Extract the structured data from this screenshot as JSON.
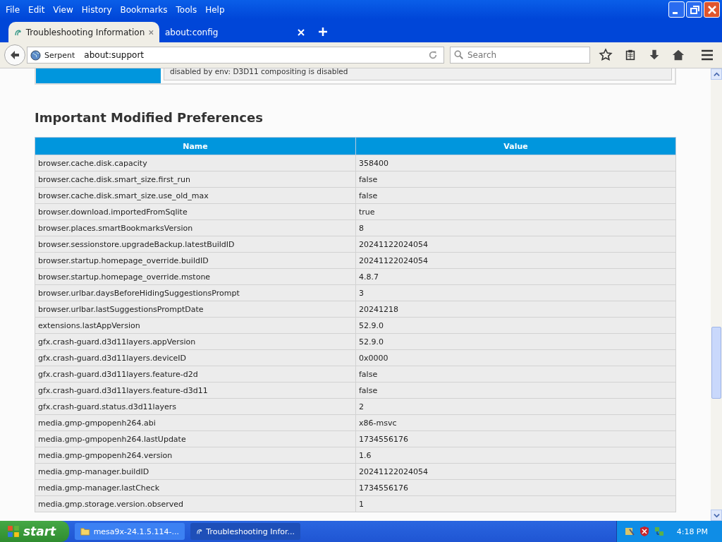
{
  "menu": [
    "File",
    "Edit",
    "View",
    "History",
    "Bookmarks",
    "Tools",
    "Help"
  ],
  "tabs": [
    {
      "label": "Troubleshooting Information",
      "selected": true
    },
    {
      "label": "about:config",
      "selected": false
    }
  ],
  "nav": {
    "identity": "Serpent",
    "url": "about:support",
    "search_placeholder": "Search"
  },
  "previous_section": {
    "note": "disabled by env: D3D11 compositing is disabled"
  },
  "section": {
    "title": "Important Modified Preferences",
    "columns": [
      "Name",
      "Value"
    ],
    "rows": [
      [
        "browser.cache.disk.capacity",
        "358400"
      ],
      [
        "browser.cache.disk.smart_size.first_run",
        "false"
      ],
      [
        "browser.cache.disk.smart_size.use_old_max",
        "false"
      ],
      [
        "browser.download.importedFromSqlite",
        "true"
      ],
      [
        "browser.places.smartBookmarksVersion",
        "8"
      ],
      [
        "browser.sessionstore.upgradeBackup.latestBuildID",
        "20241122024054"
      ],
      [
        "browser.startup.homepage_override.buildID",
        "20241122024054"
      ],
      [
        "browser.startup.homepage_override.mstone",
        "4.8.7"
      ],
      [
        "browser.urlbar.daysBeforeHidingSuggestionsPrompt",
        "3"
      ],
      [
        "browser.urlbar.lastSuggestionsPromptDate",
        "20241218"
      ],
      [
        "extensions.lastAppVersion",
        "52.9.0"
      ],
      [
        "gfx.crash-guard.d3d11layers.appVersion",
        "52.9.0"
      ],
      [
        "gfx.crash-guard.d3d11layers.deviceID",
        "0x0000"
      ],
      [
        "gfx.crash-guard.d3d11layers.feature-d2d",
        "false"
      ],
      [
        "gfx.crash-guard.d3d11layers.feature-d3d11",
        "false"
      ],
      [
        "gfx.crash-guard.status.d3d11layers",
        "2"
      ],
      [
        "media.gmp-gmpopenh264.abi",
        "x86-msvc"
      ],
      [
        "media.gmp-gmpopenh264.lastUpdate",
        "1734556176"
      ],
      [
        "media.gmp-gmpopenh264.version",
        "1.6"
      ],
      [
        "media.gmp-manager.buildID",
        "20241122024054"
      ],
      [
        "media.gmp-manager.lastCheck",
        "1734556176"
      ],
      [
        "media.gmp.storage.version.observed",
        "1"
      ]
    ]
  },
  "taskbar": {
    "start": "start",
    "tasks": [
      {
        "label": "mesa9x-24.1.5.114-...",
        "kind": "folder",
        "selected": false
      },
      {
        "label": "Troubleshooting Infor...",
        "kind": "browser",
        "selected": true
      }
    ],
    "clock": "4:18 PM"
  }
}
